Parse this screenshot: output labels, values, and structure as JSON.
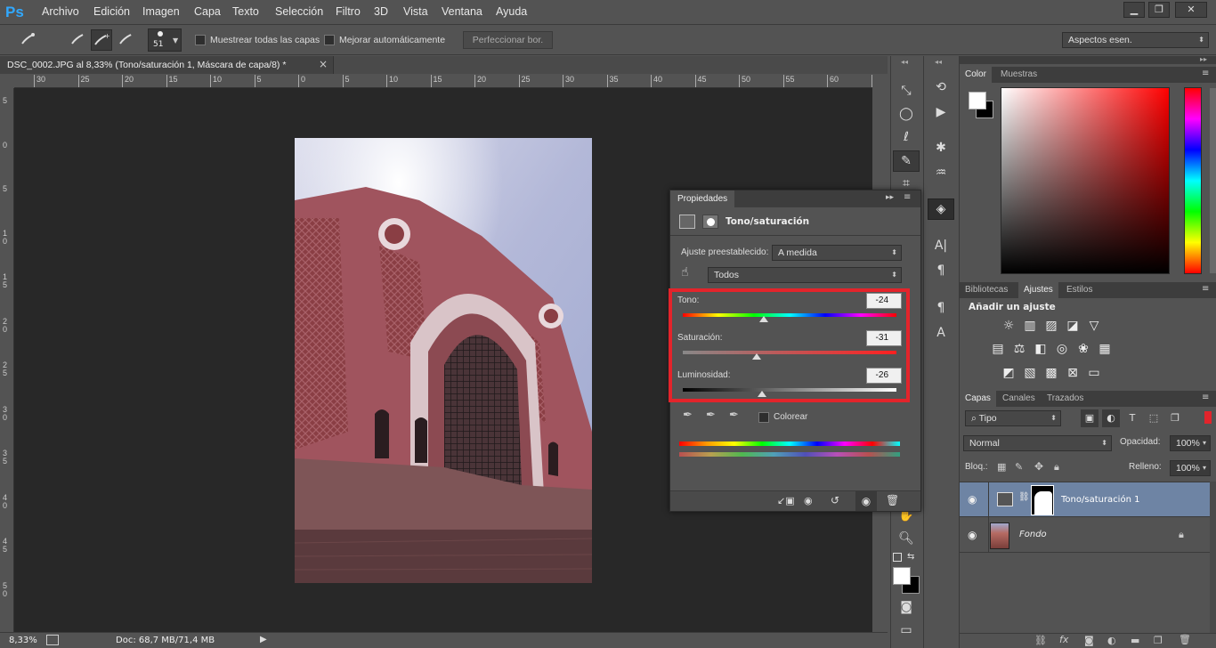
{
  "app": {
    "logo": "Ps"
  },
  "menu": [
    "Archivo",
    "Edición",
    "Imagen",
    "Capa",
    "Texto",
    "Selección",
    "Filtro",
    "3D",
    "Vista",
    "Ventana",
    "Ayuda"
  ],
  "window_controls": {
    "minimize": "▁",
    "restore": "❐",
    "close": "✕"
  },
  "options": {
    "brush_size": "51",
    "sample_all_label": "Muestrear todas las capas",
    "auto_enhance_label": "Mejorar automáticamente",
    "refine_edge_label": "Perfeccionar bor.",
    "workspace": "Aspectos esen."
  },
  "document": {
    "tab_title": "DSC_0002.JPG al 8,33% (Tono/saturación 1, Máscara de capa/8) *",
    "close": "×",
    "ruler_h": [
      "30",
      "25",
      "20",
      "15",
      "10",
      "5",
      "0",
      "5",
      "10",
      "15",
      "20",
      "25",
      "30",
      "35",
      "40",
      "45",
      "50",
      "55",
      "60",
      "6"
    ],
    "ruler_v": [
      "5",
      "0",
      "5",
      "1\n0",
      "1\n5",
      "2\n0",
      "2\n5",
      "3\n0",
      "3\n5",
      "4\n0",
      "4\n5",
      "5\n0"
    ]
  },
  "status": {
    "zoom": "8,33%",
    "doc": "Doc: 68,7 MB/71,4 MB"
  },
  "properties": {
    "tab": "Propiedades",
    "title": "Tono/saturación",
    "preset_label": "Ajuste preestablecido:",
    "preset_value": "A medida",
    "channel_value": "Todos",
    "hue_label": "Tono:",
    "hue_value": "-24",
    "hue_position": 0.38,
    "sat_label": "Saturación:",
    "sat_value": "-31",
    "sat_position": 0.345,
    "light_label": "Luminosidad:",
    "light_value": "-26",
    "light_position": 0.37,
    "colorize_label": "Colorear",
    "highlight_color": "#e3242b"
  },
  "color_panel": {
    "tabs": [
      "Color",
      "Muestras"
    ]
  },
  "adjustments_panel": {
    "tabs": [
      "Bibliotecas",
      "Ajustes",
      "Estilos"
    ],
    "title": "Añadir un ajuste"
  },
  "layers_panel": {
    "tabs": [
      "Capas",
      "Canales",
      "Trazados"
    ],
    "filter": "Tipo",
    "blend_mode": "Normal",
    "opacity_label": "Opacidad:",
    "opacity": "100%",
    "lock_label": "Bloq.:",
    "fill_label": "Relleno:",
    "fill": "100%",
    "layers": [
      {
        "name": "Tono/saturación 1",
        "selected": true
      },
      {
        "name": "Fondo",
        "selected": false
      }
    ]
  }
}
